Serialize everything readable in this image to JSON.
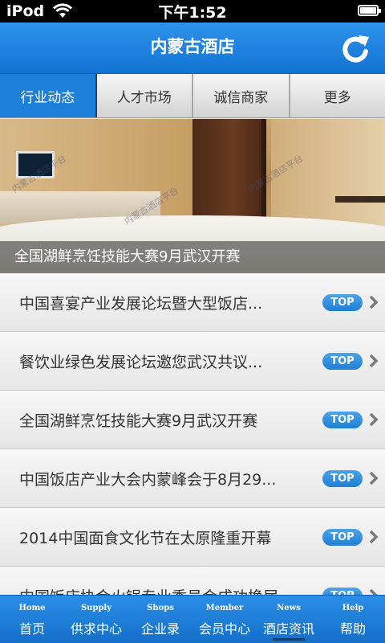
{
  "status_bar": {
    "carrier": "iPod",
    "time": "下午1:52",
    "wifi_icon": "wifi-icon",
    "battery_icon": "battery-icon"
  },
  "header": {
    "title": "内蒙古酒店",
    "refresh_icon": "refresh-icon"
  },
  "tabs": [
    {
      "label": "行业动态",
      "active": true
    },
    {
      "label": "人才市场",
      "active": false
    },
    {
      "label": "诚信商家",
      "active": false
    },
    {
      "label": "更多",
      "active": false
    }
  ],
  "banner": {
    "caption": "全国湖鲜烹饪技能大赛9月武汉开赛",
    "watermark": "内蒙古酒店平台"
  },
  "news": {
    "badge_label": "TOP",
    "items": [
      {
        "title": "中国喜宴产业发展论坛暨大型饭店..."
      },
      {
        "title": "餐饮业绿色发展论坛邀您武汉共议..."
      },
      {
        "title": "全国湖鲜烹饪技能大赛9月武汉开赛"
      },
      {
        "title": "中国饭店产业大会内蒙峰会于8月29..."
      },
      {
        "title": "2014中国面食文化节在太原隆重开幕"
      },
      {
        "title": "中国饭店协会火锅专业委员会成功换届"
      }
    ]
  },
  "bottom_nav": [
    {
      "en": "Home",
      "cn": "首页",
      "active": false
    },
    {
      "en": "Supply",
      "cn": "供求中心",
      "active": false
    },
    {
      "en": "Shops",
      "cn": "企业录",
      "active": false
    },
    {
      "en": "Member",
      "cn": "会员中心",
      "active": false
    },
    {
      "en": "News",
      "cn": "酒店资讯",
      "active": true
    },
    {
      "en": "Help",
      "cn": "帮助",
      "active": false
    }
  ],
  "colors": {
    "brand_blue": "#1c7fd9",
    "header_gradient_top": "#2d93ea",
    "header_gradient_bottom": "#1373d4"
  }
}
